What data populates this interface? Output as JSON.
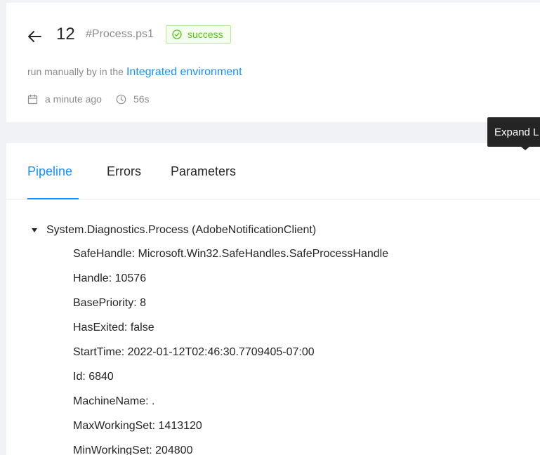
{
  "header": {
    "run_number": "12",
    "script_name": "#Process.ps1",
    "status": "success",
    "run_prefix": "run manually by in the",
    "environment_link": "Integrated environment",
    "time_ago": "a minute ago",
    "duration": "56s"
  },
  "tooltip": {
    "text": "Expand L"
  },
  "tabs": [
    {
      "label": "Pipeline",
      "active": true
    },
    {
      "label": "Errors",
      "active": false
    },
    {
      "label": "Parameters",
      "active": false
    }
  ],
  "tree": {
    "root_label": "System.Diagnostics.Process (AdobeNotificationClient)",
    "properties": [
      "SafeHandle: Microsoft.Win32.SafeHandles.SafeProcessHandle",
      "Handle: 10576",
      "BasePriority: 8",
      "HasExited: false",
      "StartTime: 2022-01-12T02:46:30.7709405-07:00",
      "Id: 6840",
      "MachineName: .",
      "MaxWorkingSet: 1413120",
      "MinWorkingSet: 204800"
    ]
  },
  "colors": {
    "accent": "#1890ff",
    "success": "#52c41a"
  },
  "icons": {
    "back": "arrow-left-icon",
    "status": "check-circle-icon",
    "calendar": "calendar-icon",
    "clock": "clock-icon",
    "expand": "caret-down-icon"
  }
}
